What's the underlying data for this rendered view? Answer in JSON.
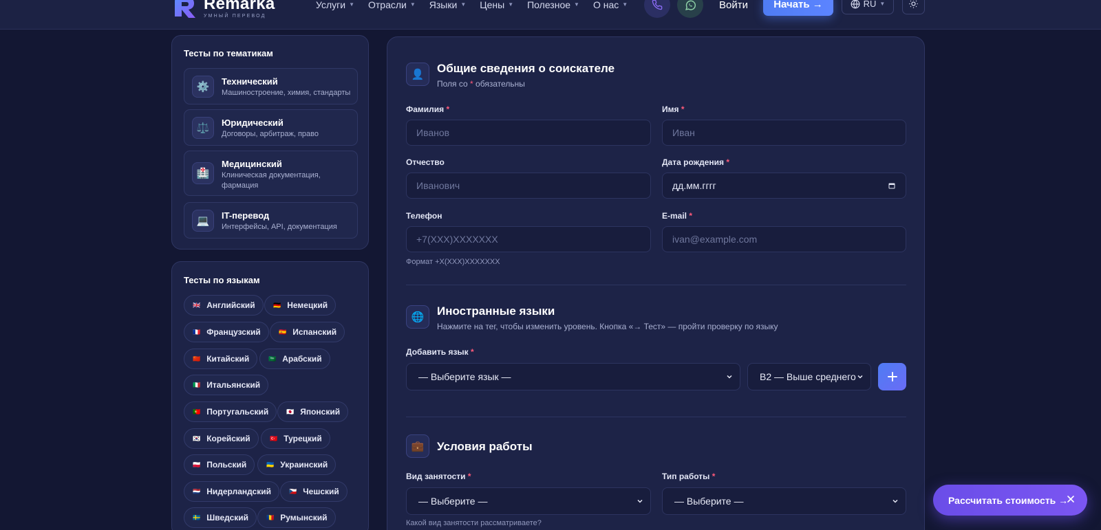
{
  "header": {
    "logo": {
      "name": "Remarka",
      "tagline": "УМНЫЙ ПЕРЕВОД"
    },
    "nav": [
      {
        "label": "Услуги"
      },
      {
        "label": "Отрасли"
      },
      {
        "label": "Языки"
      },
      {
        "label": "Цены"
      },
      {
        "label": "Полезное"
      },
      {
        "label": "О нас"
      }
    ],
    "login_label": "Войти",
    "start_label": "Начать →",
    "lang_label": "RU"
  },
  "sidebar": {
    "topics_title": "Тесты по тематикам",
    "topics": [
      {
        "icon": "⚙️",
        "title": "Технический",
        "sub": "Машиностроение, химия, стандарты"
      },
      {
        "icon": "⚖️",
        "title": "Юридический",
        "sub": "Договоры, арбитраж, право"
      },
      {
        "icon": "🏥",
        "title": "Медицинский",
        "sub": "Клиническая документация, фармация"
      },
      {
        "icon": "💻",
        "title": "IT-перевод",
        "sub": "Интерфейсы, API, документация"
      }
    ],
    "langs_title": "Тесты по языкам",
    "langs": [
      {
        "flag": "🇬🇧",
        "label": "Английский"
      },
      {
        "flag": "🇩🇪",
        "label": "Немецкий"
      },
      {
        "flag": "🇫🇷",
        "label": "Французский"
      },
      {
        "flag": "🇪🇸",
        "label": "Испанский"
      },
      {
        "flag": "🇨🇳",
        "label": "Китайский"
      },
      {
        "flag": "🇸🇦",
        "label": "Арабский"
      },
      {
        "flag": "🇮🇹",
        "label": "Итальянский"
      },
      {
        "flag": "🇵🇹",
        "label": "Португальский"
      },
      {
        "flag": "🇯🇵",
        "label": "Японский"
      },
      {
        "flag": "🇰🇷",
        "label": "Корейский"
      },
      {
        "flag": "🇹🇷",
        "label": "Турецкий"
      },
      {
        "flag": "🇵🇱",
        "label": "Польский"
      },
      {
        "flag": "🇺🇦",
        "label": "Украинский"
      },
      {
        "flag": "🇳🇱",
        "label": "Нидерландский"
      },
      {
        "flag": "🇨🇿",
        "label": "Чешский"
      },
      {
        "flag": "🇸🇪",
        "label": "Шведский"
      },
      {
        "flag": "🇷🇴",
        "label": "Румынский"
      }
    ]
  },
  "form": {
    "general": {
      "title": "Общие сведения о соискателе",
      "sub_prefix": "Поля со",
      "sub_suffix": "обязательны",
      "last_name_label": "Фамилия",
      "last_name_placeholder": "Иванов",
      "first_name_label": "Имя",
      "first_name_placeholder": "Иван",
      "patronymic_label": "Отчество",
      "patronymic_placeholder": "Иванович",
      "birth_label": "Дата рождения",
      "birth_placeholder": "дд.мм.гггг",
      "phone_label": "Телефон",
      "phone_placeholder": "+7(XXX)XXXXXXX",
      "phone_hint": "Формат +X(XXX)XXXXXXX",
      "email_label": "E-mail",
      "email_placeholder": "ivan@example.com"
    },
    "languages": {
      "title": "Иностранные языки",
      "sub": "Нажмите на тег, чтобы изменить уровень. Кнопка «→ Тест» — пройти проверку по языку",
      "add_label": "Добавить язык",
      "select_value": "— Выберите язык —",
      "level_value": "B2 — Выше среднего"
    },
    "work": {
      "title": "Условия работы",
      "employment_label": "Вид занятости",
      "employment_value": "— Выберите —",
      "employment_hint": "Какой вид занятости рассматриваете?",
      "worktype_label": "Тип работы",
      "worktype_value": "— Выберите —"
    }
  },
  "cta": {
    "label": "Рассчитать стоимость →"
  }
}
